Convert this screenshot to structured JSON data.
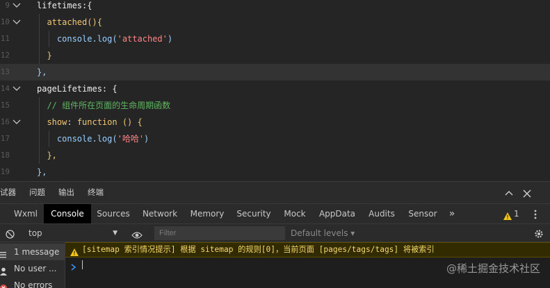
{
  "editor": {
    "lines": [
      {
        "num": "9",
        "fold": true,
        "hl": false,
        "tokens": [
          {
            "t": "lifetimes:{",
            "c": "c-key"
          }
        ]
      },
      {
        "num": "10",
        "fold": true,
        "hl": false,
        "tokens": [
          {
            "t": "  attached(){",
            "c": "c-fn"
          }
        ]
      },
      {
        "num": "11",
        "fold": false,
        "hl": false,
        "tokens": [
          {
            "t": "    console.log(",
            "c": "c-call"
          },
          {
            "t": "'attached'",
            "c": "c-str"
          },
          {
            "t": ")",
            "c": "c-call"
          }
        ]
      },
      {
        "num": "12",
        "fold": false,
        "hl": false,
        "tokens": [
          {
            "t": "  }",
            "c": "c-yellow"
          }
        ]
      },
      {
        "num": "13",
        "fold": false,
        "hl": true,
        "tokens": [
          {
            "t": "},",
            "c": "c-call"
          }
        ]
      },
      {
        "num": "14",
        "fold": true,
        "hl": false,
        "tokens": [
          {
            "t": "pageLifetimes: {",
            "c": "c-key"
          }
        ]
      },
      {
        "num": "15",
        "fold": false,
        "hl": false,
        "tokens": [
          {
            "t": "  // 组件所在页面的生命周期函数",
            "c": "c-cmt"
          }
        ]
      },
      {
        "num": "16",
        "fold": true,
        "hl": false,
        "tokens": [
          {
            "t": "  show",
            "c": "c-yellow"
          },
          {
            "t": ": ",
            "c": "c-punc"
          },
          {
            "t": "function",
            "c": "c-kw"
          },
          {
            "t": " () {",
            "c": "c-yellow"
          }
        ]
      },
      {
        "num": "17",
        "fold": false,
        "hl": false,
        "tokens": [
          {
            "t": "    console.log(",
            "c": "c-call"
          },
          {
            "t": "'哈哈'",
            "c": "c-str"
          },
          {
            "t": ")",
            "c": "c-call"
          }
        ]
      },
      {
        "num": "18",
        "fold": false,
        "hl": false,
        "tokens": [
          {
            "t": "  },",
            "c": "c-yellow"
          }
        ]
      },
      {
        "num": "19",
        "fold": false,
        "hl": false,
        "tokens": [
          {
            "t": "},",
            "c": "c-call"
          }
        ]
      }
    ]
  },
  "devtools": {
    "panel_tabs": [
      "试器",
      "问题",
      "输出",
      "终端"
    ],
    "tool_tabs": [
      "Wxml",
      "Console",
      "Sources",
      "Network",
      "Memory",
      "Security",
      "Mock",
      "AppData",
      "Audits",
      "Sensor"
    ],
    "more_label": "»",
    "warning_count": "1",
    "context_value": "top",
    "filter_placeholder": "Filter",
    "levels_label": "Default levels ▾",
    "sidebar": [
      {
        "label": "1 message",
        "icon": "list-icon"
      },
      {
        "label": "No user ...",
        "icon": "user-icon"
      },
      {
        "label": "No errors",
        "icon": "error-icon"
      }
    ],
    "warning_message": "[sitemap 索引情况提示] 根据 sitemap 的规则[0]，当前页面 [pages/tags/tags] 将被索引",
    "watermark": "@稀土掘金技术社区"
  }
}
